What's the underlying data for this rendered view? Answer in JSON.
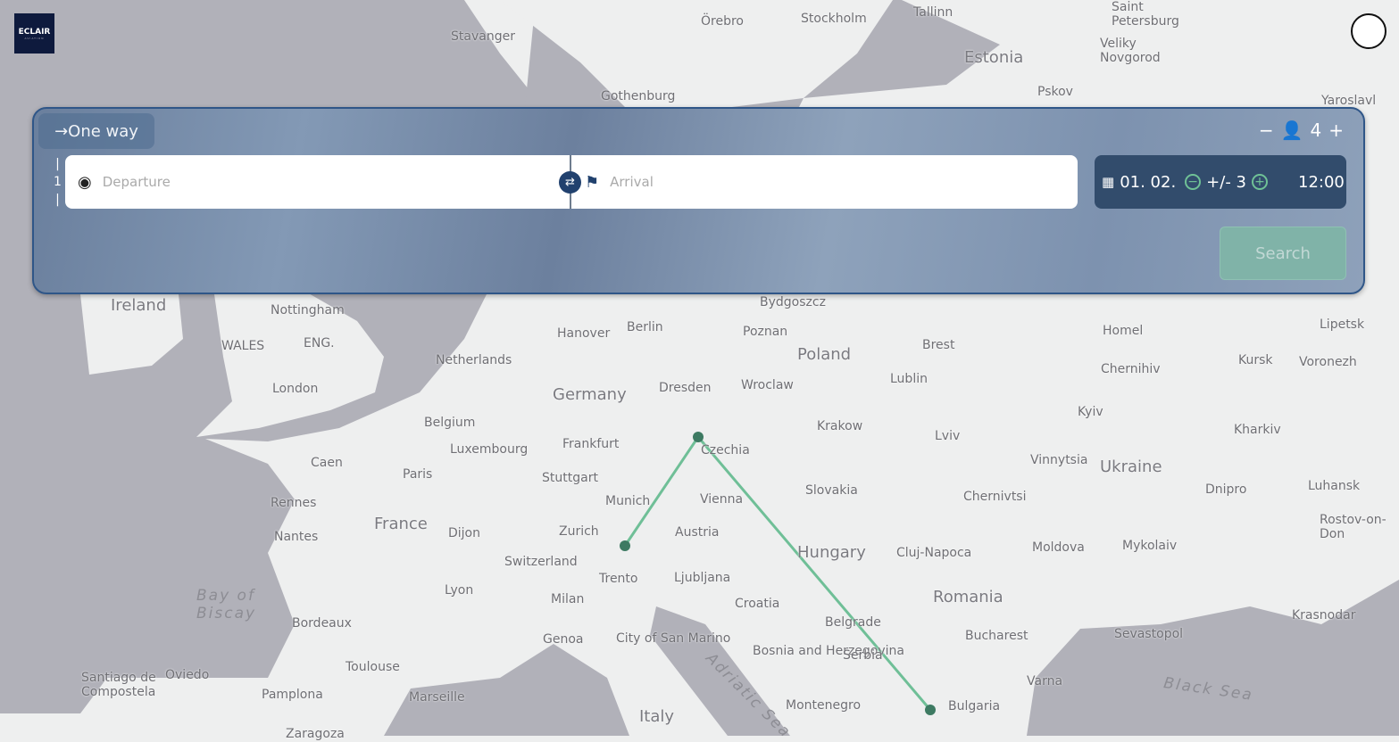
{
  "logo": {
    "text": "ECLAIR",
    "subtext": "AVIATION"
  },
  "trip_type": {
    "label": "One way",
    "icon": "arrow-right-icon"
  },
  "segment_number": "1",
  "departure": {
    "placeholder": "Departure",
    "icon": "target-icon"
  },
  "arrival": {
    "placeholder": "Arrival",
    "icon": "flag-icon"
  },
  "date": {
    "value": "01. 02.",
    "flex_label": "+/- 3",
    "time": "12:00"
  },
  "passengers": {
    "count": "4"
  },
  "search_label": "Search",
  "route_color": "#6fbf97",
  "map_labels": [
    "Saint Petersburg",
    "Stockholm",
    "Tallinn",
    "Estonia",
    "Stavanger",
    "Örebro",
    "Veliky Novgorod",
    "Pskov",
    "Gothenburg",
    "Yaroslavl",
    "Ireland",
    "Nottingham",
    "WALES",
    "ENG.",
    "London",
    "Hanover",
    "Berlin",
    "Bydgoszcz",
    "Poznan",
    "Poland",
    "Brest",
    "Homel",
    "Lipetsk",
    "Netherlands",
    "Germany",
    "Dresden",
    "Wroclaw",
    "Lublin",
    "Chernihiv",
    "Kursk",
    "Voronezh",
    "Belgium",
    "Luxembourg",
    "Frankfurt",
    "Czechia",
    "Krakow",
    "Lviv",
    "Kyiv",
    "Kharkiv",
    "Caen",
    "Paris",
    "Stuttgart",
    "Vinnytsia",
    "Ukraine",
    "Rennes",
    "Munich",
    "Vienna",
    "Slovakia",
    "Chernivtsi",
    "Dnipro",
    "Luhansk",
    "France",
    "Nantes",
    "Dijon",
    "Zurich",
    "Austria",
    "Hungary",
    "Cluj-Napoca",
    "Moldova",
    "Mykolaiv",
    "Rostov-on-Don",
    "Switzerland",
    "Trento",
    "Ljubljana",
    "Lyon",
    "Milan",
    "Croatia",
    "Romania",
    "Bay of Biscay",
    "Bordeaux",
    "Belgrade",
    "Krasnodar",
    "Genoa",
    "City of San Marino",
    "Bosnia and Herzegovina",
    "Serbia",
    "Bucharest",
    "Sevastopol",
    "Toulouse",
    "Santiago de Compostela",
    "Oviedo",
    "Varna",
    "Black Sea",
    "Pamplona",
    "Marseille",
    "Italy",
    "Adriatic Sea",
    "Montenegro",
    "Bulgaria",
    "Zaragoza"
  ]
}
